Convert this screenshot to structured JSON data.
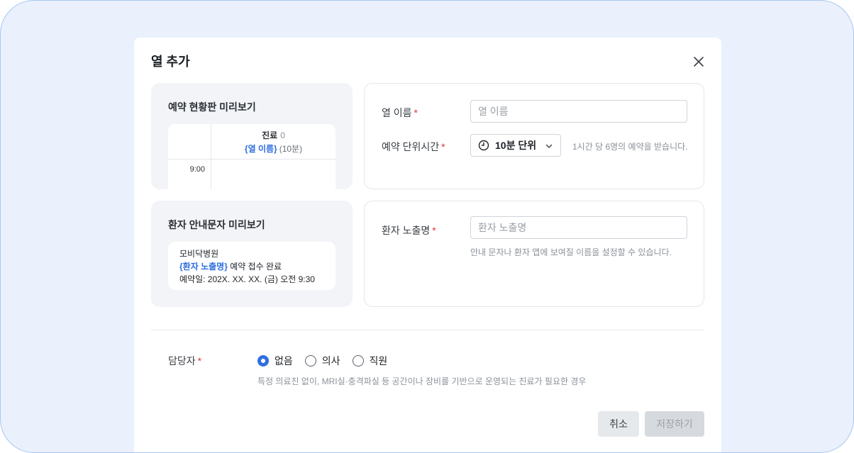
{
  "dialog": {
    "title": "열 추가"
  },
  "board_preview": {
    "title": "예약 현황판 미리보기",
    "column_name": "진료",
    "column_count": "0",
    "column_placeholder": "{열 이름}",
    "column_unit": "(10분)",
    "time_label": "9:00"
  },
  "message_preview": {
    "title": "환자 안내문자 미리보기",
    "hospital": "모비닥병원",
    "placeholder": "{환자 노출명}",
    "line2_rest": " 예약 접수 완료",
    "line3": "예약일: 202X. XX. XX. (금) 오전 9:30"
  },
  "column_form": {
    "name_label": "열 이름",
    "name_placeholder": "열 이름",
    "name_value": "",
    "unit_label": "예약 단위시간",
    "unit_value": "10분 단위",
    "unit_help": "1시간 당 6명의 예약을 받습니다."
  },
  "patient_form": {
    "display_label": "환자 노출명",
    "display_placeholder": "환자 노출명",
    "display_value": "",
    "display_help": "안내 문자나 환자 앱에 보여질 이름을 설정할 수 있습니다."
  },
  "assignee": {
    "label": "담당자",
    "required_mark": "*",
    "options": [
      {
        "label": "없음",
        "checked": true
      },
      {
        "label": "의사",
        "checked": false
      },
      {
        "label": "직원",
        "checked": false
      }
    ],
    "help": "특정 의료진 없이, MRI실·충격파실 등 공간이나 장비를 기반으로 운영되는 진료가 필요한 경우"
  },
  "required_mark": "*",
  "buttons": {
    "cancel": "취소",
    "save": "저장하기"
  },
  "colors": {
    "accent": "#2f6fe0",
    "required": "#e0353b",
    "frame_bg": "#eaf1fd",
    "frame_border": "#a9c6f2"
  },
  "icons": {
    "close": "close-icon",
    "clock": "clock-icon",
    "chevron": "chevron-down-icon"
  }
}
